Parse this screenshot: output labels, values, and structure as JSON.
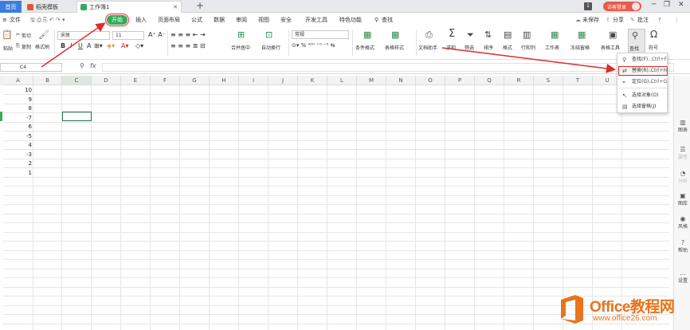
{
  "tabs": {
    "home": "首页",
    "docer": "稻壳模板",
    "workbook": "工作簿1",
    "badge": "1",
    "visitor": "访客登录"
  },
  "menu": {
    "file": "文件",
    "items": [
      "开始",
      "插入",
      "页面布局",
      "公式",
      "数据",
      "审阅",
      "视图",
      "安全",
      "开发工具",
      "特色功能"
    ],
    "search": "查找",
    "unsaved": "未保存",
    "share": "分享",
    "batch": "批注"
  },
  "ribbon": {
    "cut": "剪切",
    "paste": "粘贴",
    "copy": "复制",
    "format_painter": "格式刷",
    "font_name": "宋体",
    "font_size": "11",
    "merge": "合并居中",
    "wrap": "自动换行",
    "num_format": "常规",
    "cond_format": "条件格式",
    "table_style": "表格样式",
    "doc_helper": "文档助手",
    "sum": "求和",
    "filter": "筛选",
    "sort": "排序",
    "format": "格式",
    "rowcol": "行和列",
    "worksheet": "工作表",
    "freeze": "冻结窗格",
    "tools": "表格工具",
    "find": "查找",
    "symbol": "符号"
  },
  "formula_bar": {
    "cell_ref": "C4",
    "fx": "fx"
  },
  "columns": [
    "A",
    "B",
    "C",
    "D",
    "E",
    "F",
    "G",
    "H",
    "I",
    "J",
    "K",
    "L",
    "M",
    "N",
    "O",
    "P",
    "Q",
    "R",
    "S",
    "T",
    "U"
  ],
  "values": [
    "10",
    "9",
    "8",
    "-7",
    "6",
    "-5",
    "4",
    "-3",
    "2",
    "1"
  ],
  "dropdown": {
    "items": [
      {
        "label": "查找(F)...",
        "shortcut": "Ctrl+F"
      },
      {
        "label": "替换(R)...",
        "shortcut": "Ctrl+H"
      },
      {
        "label": "定位(G)...",
        "shortcut": "Ctrl+G"
      },
      {
        "label": "选择对象(O)",
        "shortcut": ""
      },
      {
        "label": "选择窗格(J)",
        "shortcut": ""
      }
    ]
  },
  "side_panel": [
    "图表",
    "属性",
    "分析",
    "图库",
    "风格",
    "帮助",
    "设置"
  ],
  "watermark": {
    "brand": "Office教程网",
    "url": "www.office26.com"
  },
  "colors": {
    "accent_green": "#35a85b",
    "highlight_red": "#e02b2b",
    "brand_orange": "#e8741c",
    "home_tab_blue": "#3b7de0"
  }
}
